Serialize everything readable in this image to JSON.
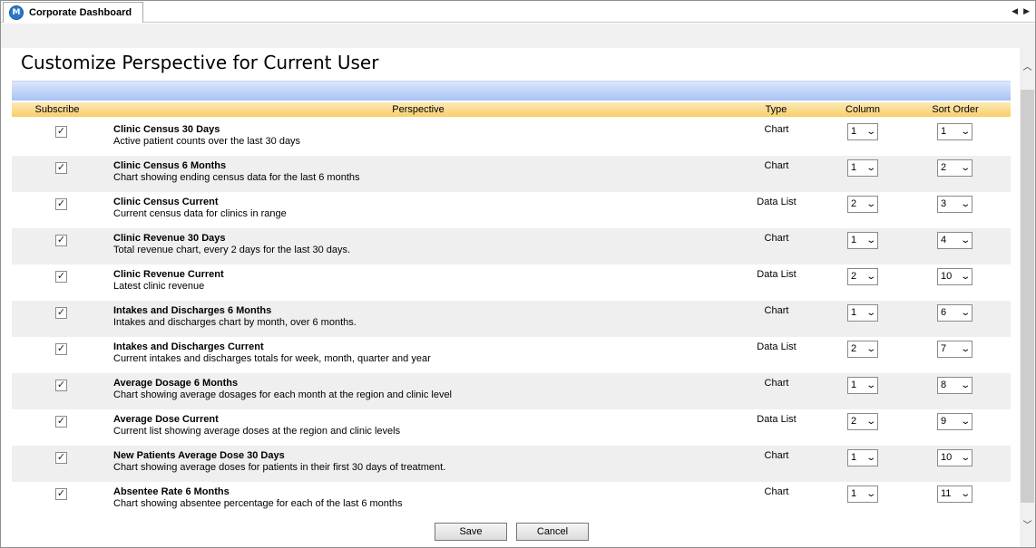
{
  "tab": {
    "title": "Corporate Dashboard",
    "icon": "M"
  },
  "page": {
    "title": "Customize Perspective for Current User"
  },
  "headers": {
    "subscribe": "Subscribe",
    "perspective": "Perspective",
    "type": "Type",
    "column": "Column",
    "sort_order": "Sort Order"
  },
  "rows": [
    {
      "title": "Clinic Census 30 Days",
      "desc": "Active patient counts over the last 30 days",
      "type": "Chart",
      "column": "1",
      "sort": "1",
      "subscribed": true
    },
    {
      "title": "Clinic Census 6 Months",
      "desc": "Chart showing ending census data for the last 6 months",
      "type": "Chart",
      "column": "1",
      "sort": "2",
      "subscribed": true
    },
    {
      "title": "Clinic Census Current",
      "desc": "Current census data for clinics in range",
      "type": "Data List",
      "column": "2",
      "sort": "3",
      "subscribed": true
    },
    {
      "title": "Clinic Revenue 30 Days",
      "desc": "Total revenue chart, every 2 days for the last 30 days.",
      "type": "Chart",
      "column": "1",
      "sort": "4",
      "subscribed": true
    },
    {
      "title": "Clinic Revenue Current",
      "desc": "Latest clinic revenue",
      "type": "Data List",
      "column": "2",
      "sort": "10",
      "subscribed": true
    },
    {
      "title": "Intakes and Discharges 6 Months",
      "desc": "Intakes and discharges chart by month, over 6 months.",
      "type": "Chart",
      "column": "1",
      "sort": "6",
      "subscribed": true
    },
    {
      "title": "Intakes and Discharges Current",
      "desc": "Current intakes and discharges totals for week, month, quarter and year",
      "type": "Data List",
      "column": "2",
      "sort": "7",
      "subscribed": true
    },
    {
      "title": "Average Dosage 6 Months",
      "desc": "Chart showing average dosages for each month at the region and clinic level",
      "type": "Chart",
      "column": "1",
      "sort": "8",
      "subscribed": true
    },
    {
      "title": "Average Dose Current",
      "desc": "Current list showing average doses at the region and clinic levels",
      "type": "Data List",
      "column": "2",
      "sort": "9",
      "subscribed": true
    },
    {
      "title": "New Patients Average Dose 30 Days",
      "desc": "Chart showing average doses for patients in their first 30 days of treatment.",
      "type": "Chart",
      "column": "1",
      "sort": "10",
      "subscribed": true
    },
    {
      "title": "Absentee Rate 6 Months",
      "desc": "Chart showing absentee percentage for each of the last 6 months",
      "type": "Chart",
      "column": "1",
      "sort": "11",
      "subscribed": true
    }
  ],
  "buttons": {
    "save": "Save",
    "cancel": "Cancel"
  },
  "colors": {
    "header_band": "#f7cf6c",
    "blue_band": "#a8c4f3",
    "row_alt": "#efefef"
  }
}
